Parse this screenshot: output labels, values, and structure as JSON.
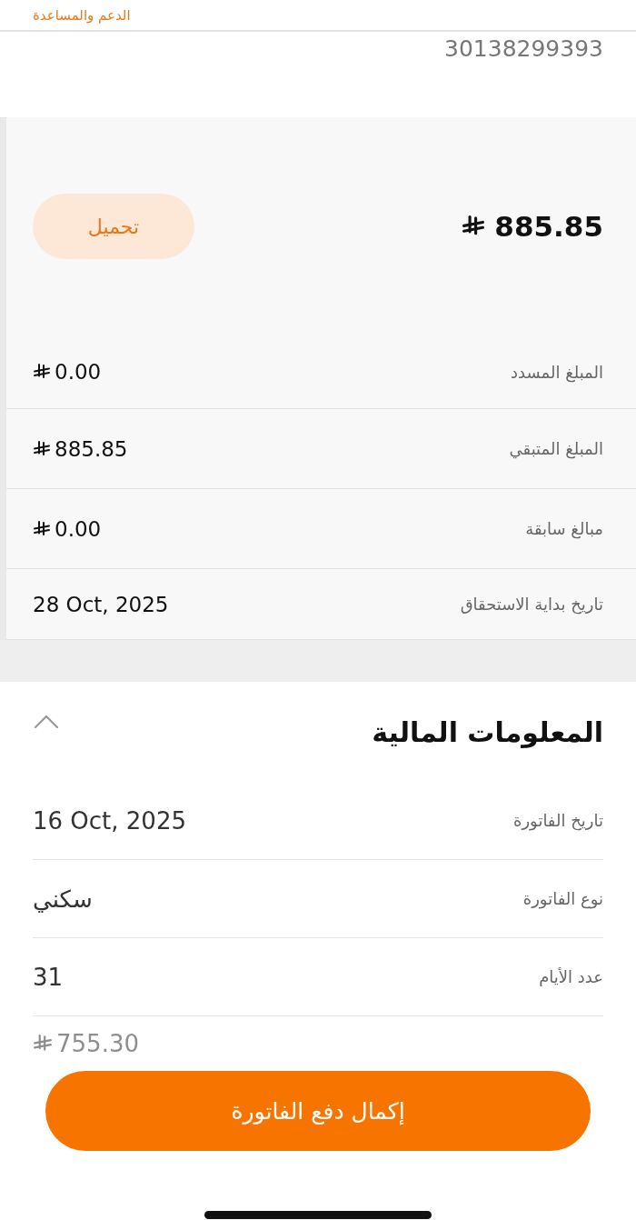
{
  "support_link": "الدعم والمساعدة",
  "account_number": "30138299393",
  "summary": {
    "total": "885.85",
    "download_button": "تحميل",
    "rows": [
      {
        "label": "المبلغ المسدد",
        "value": "0.00",
        "currency": true
      },
      {
        "label": "المبلغ المتبقي",
        "value": "885.85",
        "currency": true
      },
      {
        "label": "مبالغ سابقة",
        "value": "0.00",
        "currency": true
      },
      {
        "label": "تاريخ بداية الاستحقاق",
        "value": "28 Oct, 2025",
        "currency": false
      }
    ]
  },
  "financial_info": {
    "title": "المعلومات المالية",
    "expanded": true,
    "rows": [
      {
        "label": "تاريخ الفاتورة",
        "value": "16 Oct, 2025",
        "currency": false,
        "faded": false
      },
      {
        "label": "نوع الفاتورة",
        "value": "سكني",
        "currency": false,
        "faded": false
      },
      {
        "label": "عدد الأيام",
        "value": "31",
        "currency": false,
        "faded": false
      },
      {
        "value": "755.30",
        "currency": true,
        "faded": true
      }
    ]
  },
  "pay_button": "إكمال دفع الفاتورة"
}
